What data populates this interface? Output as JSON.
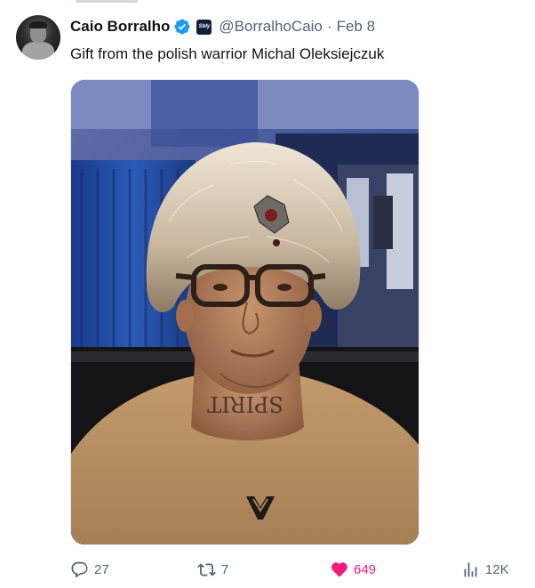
{
  "author": {
    "name": "Caio Borralho",
    "handle": "@BorralhoCaio",
    "date": "Feb 8",
    "verified": true,
    "affiliate_badge_text": "Sbly"
  },
  "tweet": {
    "text": "Gift from the polish warrior Michal Oleksiejczuk",
    "image_tattoo_text": "SPIRIT",
    "image_logo": "venum-logo"
  },
  "actions": {
    "replies": "27",
    "reposts": "7",
    "likes": "649",
    "views": "12K",
    "liked": true
  },
  "colors": {
    "like": "#f91880",
    "secondary_text": "#536471",
    "verified_blue": "#1d9bf0"
  },
  "icons": [
    "reply-icon",
    "repost-icon",
    "like-icon",
    "views-icon",
    "verified-icon"
  ]
}
